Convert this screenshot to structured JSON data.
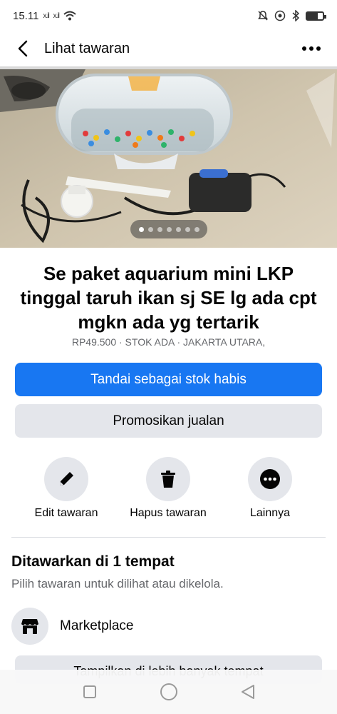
{
  "status_bar": {
    "time": "15.11",
    "signal_1": "x.il",
    "signal_2": "x.il",
    "battery_level": 0.7,
    "icons": [
      "wifi-icon",
      "alarm-off-icon",
      "data-saver-icon",
      "bluetooth-icon",
      "battery-icon"
    ]
  },
  "header": {
    "title": "Lihat tawaran",
    "back_icon": "chevron-left-icon",
    "more_icon": "more-horizontal-icon"
  },
  "photo": {
    "page_count": 7,
    "current_page": 1
  },
  "listing": {
    "title": "Se paket aquarium mini LKP tinggal taruh ikan sj SE lg ada cpt mgkn ada yg tertarik",
    "meta": "RP49.500 · STOK ADA · JAKARTA UTARA,"
  },
  "buttons": {
    "primary": "Tandai sebagai stok habis",
    "secondary": "Promosikan jualan"
  },
  "actions": [
    {
      "label": "Edit tawaran",
      "icon": "pencil-icon"
    },
    {
      "label": "Hapus tawaran",
      "icon": "trash-icon"
    },
    {
      "label": "Lainnya",
      "icon": "more-circle-icon"
    }
  ],
  "section": {
    "title": "Ditawarkan di 1 tempat",
    "subtitle": "Pilih tawaran untuk dilihat atau dikelola.",
    "place": {
      "label": "Marketplace",
      "icon": "storefront-icon"
    }
  },
  "partial_button": {
    "label": "Tampilkan di lebih banyak tempat"
  },
  "nav": {
    "icons": [
      "recents-square-icon",
      "home-circle-icon",
      "back-triangle-icon"
    ]
  },
  "colors": {
    "accent": "#1877f2",
    "secondary_bg": "#e4e6eb",
    "muted_text": "#65676b"
  }
}
